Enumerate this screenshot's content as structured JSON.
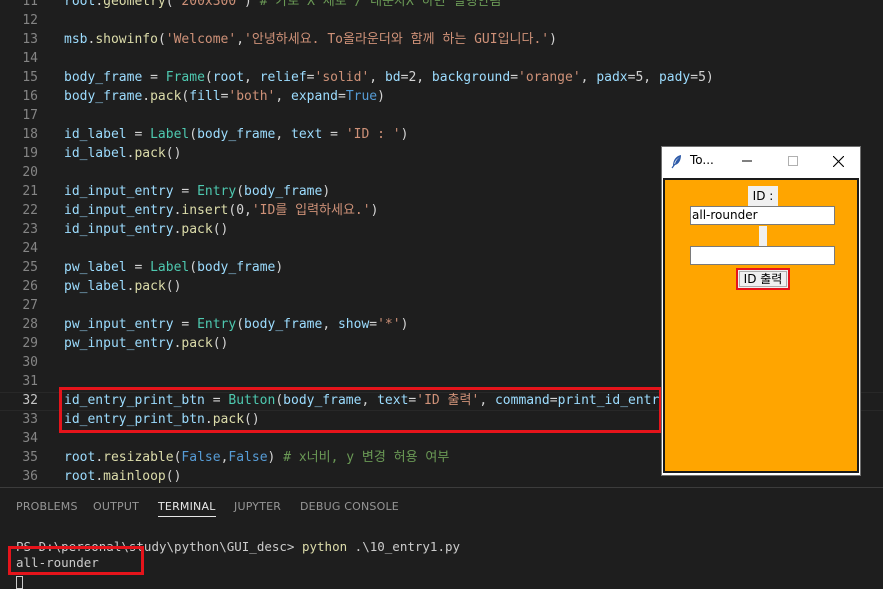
{
  "editor": {
    "lines": [
      {
        "num": "11",
        "tokens": [
          [
            "v",
            "root"
          ],
          [
            "p",
            "."
          ],
          [
            "f",
            "geometry"
          ],
          [
            "p",
            "("
          ],
          [
            "s",
            "'200x300'"
          ],
          [
            "p",
            ") "
          ],
          [
            "m",
            "# 가로 X 세로 / 대문자X 하면 실행안됨"
          ]
        ]
      },
      {
        "num": "12",
        "tokens": []
      },
      {
        "num": "13",
        "tokens": [
          [
            "v",
            "msb"
          ],
          [
            "p",
            "."
          ],
          [
            "f",
            "showinfo"
          ],
          [
            "p",
            "("
          ],
          [
            "s",
            "'Welcome'"
          ],
          [
            "p",
            ","
          ],
          [
            "s",
            "'안녕하세요. To올라운더와 함께 하는 GUI입니다.'"
          ],
          [
            "p",
            ")"
          ]
        ]
      },
      {
        "num": "14",
        "tokens": []
      },
      {
        "num": "15",
        "tokens": [
          [
            "v",
            "body_frame"
          ],
          [
            "o",
            " = "
          ],
          [
            "c",
            "Frame"
          ],
          [
            "p",
            "("
          ],
          [
            "v",
            "root"
          ],
          [
            "p",
            ", "
          ],
          [
            "v",
            "relief"
          ],
          [
            "o",
            "="
          ],
          [
            "s",
            "'solid'"
          ],
          [
            "p",
            ", "
          ],
          [
            "v",
            "bd"
          ],
          [
            "o",
            "="
          ],
          [
            "p",
            "2, "
          ],
          [
            "v",
            "background"
          ],
          [
            "o",
            "="
          ],
          [
            "s",
            "'orange'"
          ],
          [
            "p",
            ", "
          ],
          [
            "v",
            "padx"
          ],
          [
            "o",
            "="
          ],
          [
            "p",
            "5, "
          ],
          [
            "v",
            "pady"
          ],
          [
            "o",
            "="
          ],
          [
            "p",
            "5)"
          ]
        ]
      },
      {
        "num": "16",
        "tokens": [
          [
            "v",
            "body_frame"
          ],
          [
            "p",
            "."
          ],
          [
            "f",
            "pack"
          ],
          [
            "p",
            "("
          ],
          [
            "v",
            "fill"
          ],
          [
            "o",
            "="
          ],
          [
            "s",
            "'both'"
          ],
          [
            "p",
            ", "
          ],
          [
            "v",
            "expand"
          ],
          [
            "o",
            "="
          ],
          [
            "k",
            "True"
          ],
          [
            "p",
            ")"
          ]
        ]
      },
      {
        "num": "17",
        "tokens": []
      },
      {
        "num": "18",
        "tokens": [
          [
            "v",
            "id_label"
          ],
          [
            "o",
            " = "
          ],
          [
            "c",
            "Label"
          ],
          [
            "p",
            "("
          ],
          [
            "v",
            "body_frame"
          ],
          [
            "p",
            ", "
          ],
          [
            "v",
            "text"
          ],
          [
            "o",
            " = "
          ],
          [
            "s",
            "'ID : '"
          ],
          [
            "p",
            ")"
          ]
        ]
      },
      {
        "num": "19",
        "tokens": [
          [
            "v",
            "id_label"
          ],
          [
            "p",
            "."
          ],
          [
            "f",
            "pack"
          ],
          [
            "p",
            "()"
          ]
        ]
      },
      {
        "num": "20",
        "tokens": []
      },
      {
        "num": "21",
        "tokens": [
          [
            "v",
            "id_input_entry"
          ],
          [
            "o",
            " = "
          ],
          [
            "c",
            "Entry"
          ],
          [
            "p",
            "("
          ],
          [
            "v",
            "body_frame"
          ],
          [
            "p",
            ")"
          ]
        ]
      },
      {
        "num": "22",
        "tokens": [
          [
            "v",
            "id_input_entry"
          ],
          [
            "p",
            "."
          ],
          [
            "f",
            "insert"
          ],
          [
            "p",
            "(0,"
          ],
          [
            "s",
            "'ID를 입력하세요.'"
          ],
          [
            "p",
            ")"
          ]
        ]
      },
      {
        "num": "23",
        "tokens": [
          [
            "v",
            "id_input_entry"
          ],
          [
            "p",
            "."
          ],
          [
            "f",
            "pack"
          ],
          [
            "p",
            "()"
          ]
        ]
      },
      {
        "num": "24",
        "tokens": []
      },
      {
        "num": "25",
        "tokens": [
          [
            "v",
            "pw_label"
          ],
          [
            "o",
            " = "
          ],
          [
            "c",
            "Label"
          ],
          [
            "p",
            "("
          ],
          [
            "v",
            "body_frame"
          ],
          [
            "p",
            ")"
          ]
        ]
      },
      {
        "num": "26",
        "tokens": [
          [
            "v",
            "pw_label"
          ],
          [
            "p",
            "."
          ],
          [
            "f",
            "pack"
          ],
          [
            "p",
            "()"
          ]
        ]
      },
      {
        "num": "27",
        "tokens": []
      },
      {
        "num": "28",
        "tokens": [
          [
            "v",
            "pw_input_entry"
          ],
          [
            "o",
            " = "
          ],
          [
            "c",
            "Entry"
          ],
          [
            "p",
            "("
          ],
          [
            "v",
            "body_frame"
          ],
          [
            "p",
            ", "
          ],
          [
            "v",
            "show"
          ],
          [
            "o",
            "="
          ],
          [
            "s",
            "'*'"
          ],
          [
            "p",
            ")"
          ]
        ]
      },
      {
        "num": "29",
        "tokens": [
          [
            "v",
            "pw_input_entry"
          ],
          [
            "p",
            "."
          ],
          [
            "f",
            "pack"
          ],
          [
            "p",
            "()"
          ]
        ]
      },
      {
        "num": "30",
        "tokens": []
      },
      {
        "num": "31",
        "tokens": []
      },
      {
        "num": "32",
        "tokens": [
          [
            "v",
            "id_entry_print_btn"
          ],
          [
            "o",
            " = "
          ],
          [
            "c",
            "Button"
          ],
          [
            "p",
            "("
          ],
          [
            "v",
            "body_frame"
          ],
          [
            "p",
            ", "
          ],
          [
            "v",
            "text"
          ],
          [
            "o",
            "="
          ],
          [
            "s",
            "'ID 출력'"
          ],
          [
            "p",
            ", "
          ],
          [
            "v",
            "command"
          ],
          [
            "o",
            "="
          ],
          [
            "v",
            "print_id_entry"
          ]
        ]
      },
      {
        "num": "33",
        "tokens": [
          [
            "v",
            "id_entry_print_btn"
          ],
          [
            "p",
            "."
          ],
          [
            "f",
            "pack"
          ],
          [
            "p",
            "()"
          ]
        ]
      },
      {
        "num": "34",
        "tokens": []
      },
      {
        "num": "35",
        "tokens": [
          [
            "v",
            "root"
          ],
          [
            "p",
            "."
          ],
          [
            "f",
            "resizable"
          ],
          [
            "p",
            "("
          ],
          [
            "k",
            "False"
          ],
          [
            "p",
            ","
          ],
          [
            "k",
            "False"
          ],
          [
            "p",
            ") "
          ],
          [
            "m",
            "# x너비, y 변경 허용 여부"
          ]
        ]
      },
      {
        "num": "36",
        "tokens": [
          [
            "v",
            "root"
          ],
          [
            "p",
            "."
          ],
          [
            "f",
            "mainloop"
          ],
          [
            "p",
            "()"
          ]
        ]
      }
    ]
  },
  "panel": {
    "tabs": [
      "PROBLEMS",
      "OUTPUT",
      "TERMINAL",
      "JUPYTER",
      "DEBUG CONSOLE"
    ],
    "active_tab": "TERMINAL",
    "terminal": {
      "prompt": "PS D:\\personal\\study\\python\\GUI_desc> ",
      "command": "python",
      "args": " .\\10_entry1.py",
      "output": "all-rounder"
    }
  },
  "tk_window": {
    "title": "To...",
    "id_label": "ID :",
    "id_entry_value": "all-rounder",
    "pw_entry_value": "",
    "button_label": "ID 출력",
    "frame_color": "#ffa500"
  },
  "colors": {
    "highlight_box": "#e5141b",
    "editor_bg": "#1e1e1e"
  }
}
